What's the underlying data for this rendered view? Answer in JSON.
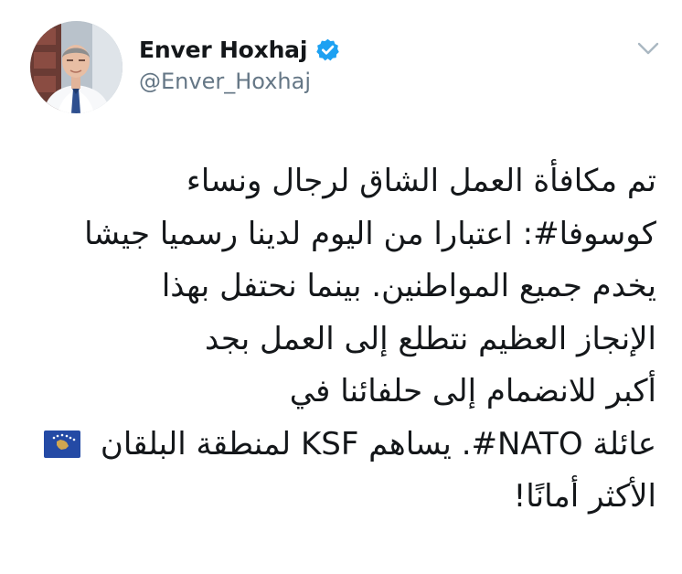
{
  "author": {
    "display_name": "Enver Hoxhaj",
    "handle": "@Enver_Hoxhaj",
    "verified": true
  },
  "icons": {
    "verified": "verified-badge-icon",
    "menu": "chevron-down-icon",
    "flag": "kosovo-flag-icon"
  },
  "colors": {
    "text": "#14171a",
    "secondary_text": "#657786",
    "verified_blue": "#1da1f2",
    "chevron": "#aab8c2",
    "flag_blue": "#244aa5",
    "flag_gold": "#d0a650"
  },
  "tweet": {
    "lines": [
      "تم مكافأة العمل الشاق لرجال ونساء",
      "كوسوفا#: اعتبارا من اليوم لدينا رسميا جيشا",
      "يخدم جميع المواطنين. بينما نحتفل بهذا",
      "الإنجاز العظيم نتطلع إلى العمل بجد",
      "أكبر للانضمام إلى حلفائنا في",
      "عائلة NATO#. يساهم KSF لمنطقة البلقان",
      "الأكثر أمانًا!"
    ]
  }
}
